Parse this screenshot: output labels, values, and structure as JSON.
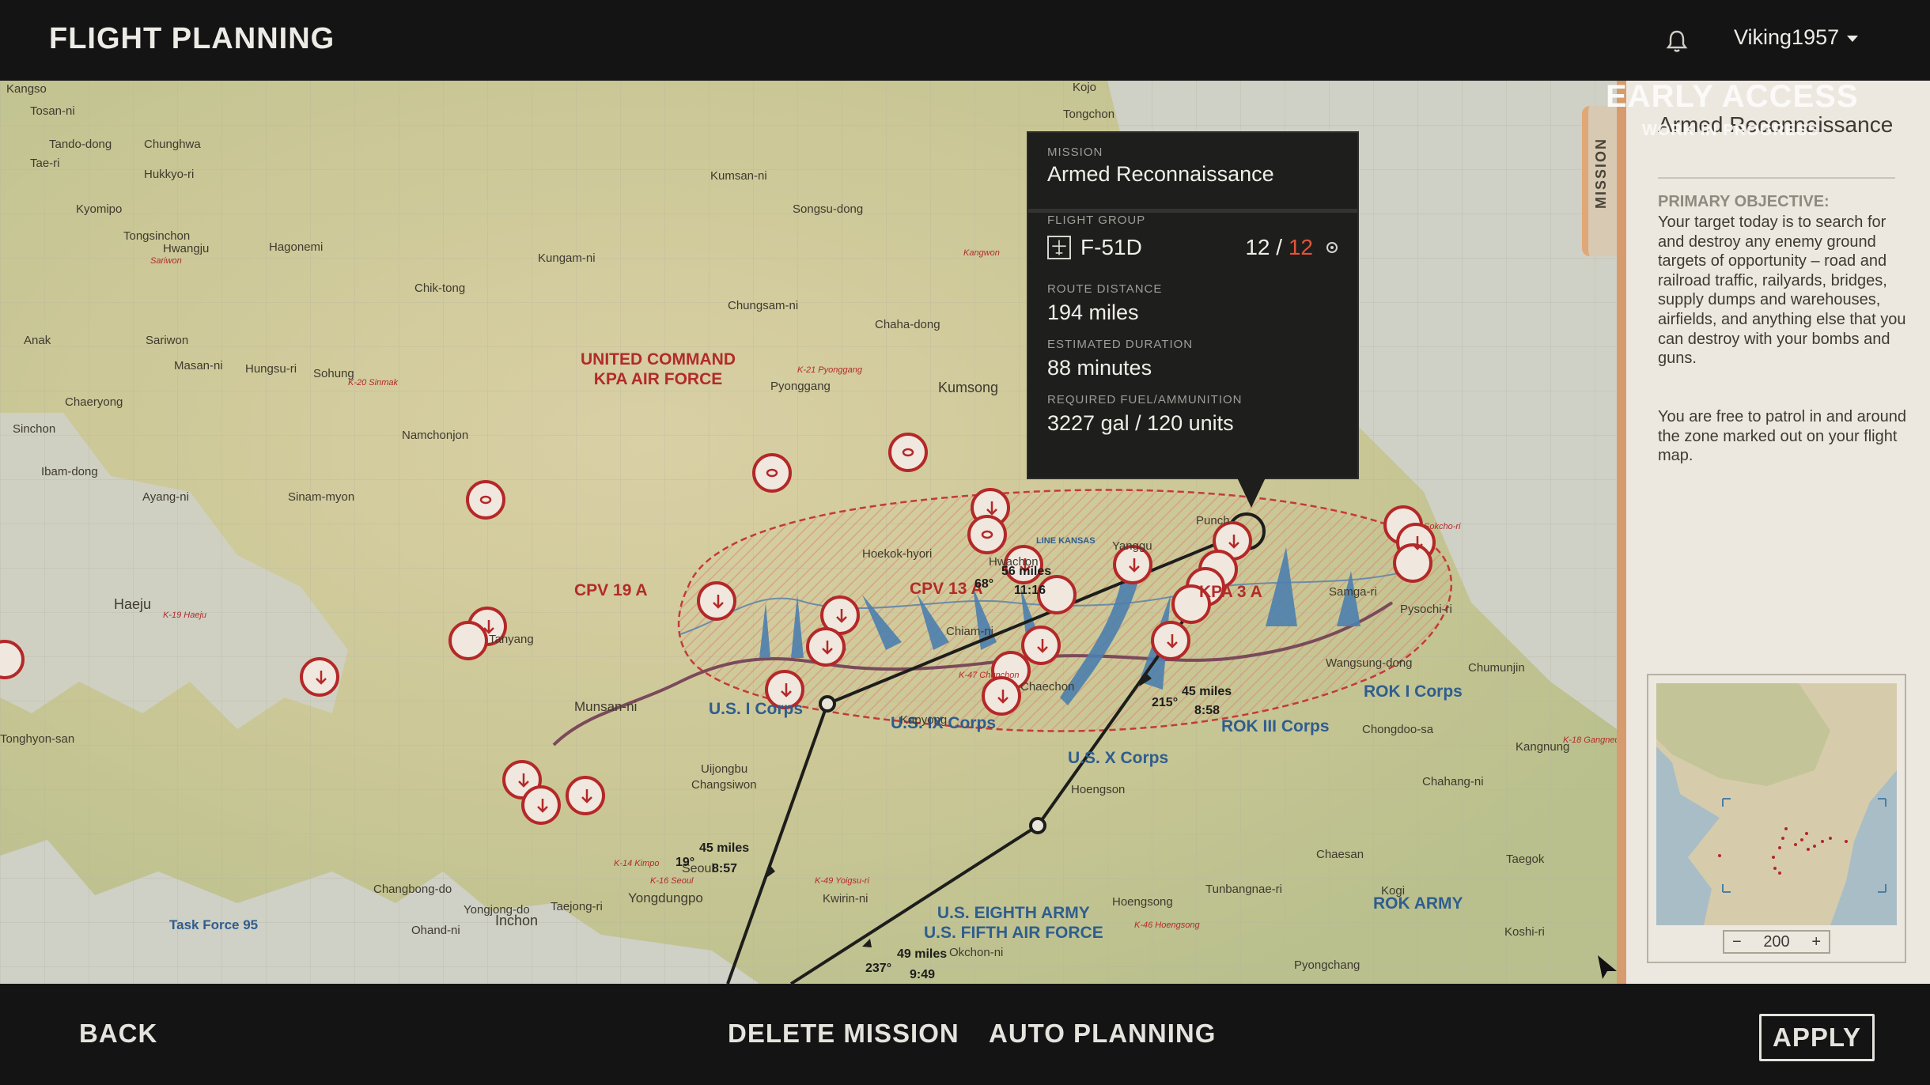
{
  "app": {
    "title": "FLIGHT PLANNING",
    "user": "Viking1957"
  },
  "mission_card": {
    "mission_label": "MISSION",
    "mission_name": "Armed Reconnaissance",
    "flight_group_label": "FLIGHT GROUP",
    "aircraft": "F-51D",
    "count_current": "12",
    "count_sep": " / ",
    "count_max": "12",
    "route_distance_label": "ROUTE DISTANCE",
    "route_distance": "194 miles",
    "duration_label": "ESTIMATED DURATION",
    "duration": "88 minutes",
    "fuel_label": "REQUIRED FUEL/AMMUNITION",
    "fuel": "3227 gal / 120 units"
  },
  "sidebar": {
    "tab": "MISSION",
    "badge": "EARLY ACCESS",
    "badge_sub": "WORK IN PROGRESS",
    "title": "Armed Reconnaissance",
    "objective_heading": "PRIMARY OBJECTIVE:",
    "objective_text": "Your target today is to search for and destroy any enemy ground targets of opportunity – road and railroad traffic, railyards, bridges, supply dumps and warehouses, airfields, and anything else that you can destroy with your bombs and guns.",
    "objective_text2": "You are free to patrol in and around the zone marked out on your flight map.",
    "zoom_minus": "−",
    "zoom_value": "200",
    "zoom_plus": "+"
  },
  "bottom": {
    "back": "BACK",
    "delete": "DELETE MISSION",
    "auto": "AUTO PLANNING",
    "apply": "APPLY"
  },
  "map": {
    "labels": {
      "kpa": "UNITED COMMAND\nKPA AIR FORCE",
      "cpv19": "CPV 19 A",
      "cpv13": "CPV 13 A",
      "kpa3": "KPA 3 A",
      "usi": "U.S. I Corps",
      "usix": "U.S. IX Corps",
      "usx": "U.S. X Corps",
      "roki": "ROK I Corps",
      "rokiii": "ROK III Corps",
      "rokarmy": "ROK ARMY",
      "eighth": "U.S. EIGHTH ARMY\nU.S. FIFTH AIR FORCE",
      "tf95": "Task Force 95",
      "line_kansas": "LINE KANSAS"
    },
    "places": [
      "Kangso",
      "Tosan-ni",
      "Tando-dong",
      "Chunghwa",
      "Hukkyo-ri",
      "Tae-ri",
      "Kyomipo",
      "Tongsinchon",
      "Hwangju",
      "Sariwon",
      "Hagonemi",
      "Kungam-ni",
      "Kumsan-ni",
      "Songsu-dong",
      "Chik-tong",
      "Chungsam-ni",
      "Chaha-dong",
      "Anak",
      "Masan-ni",
      "Hungsu-ri",
      "Sohung",
      "Chaeryong",
      "Pyonggang",
      "Kumsong",
      "Sinchon",
      "Namchonjon",
      "Ibam-dong",
      "Ayang-ni",
      "Sinam-myon",
      "Haeju",
      "Hoekok-hyori",
      "Munsan-ni",
      "Uijongbu",
      "Changsiwon",
      "Seoul",
      "Yongdungpo",
      "Kwirin-ni",
      "Okchon-ni",
      "Inchon",
      "Ohand-ni",
      "Chaechon",
      "Changbong-do",
      "Yongjong-do",
      "Taejong-ri",
      "Chumunjin",
      "Chongdoo-sa",
      "Kangnung",
      "Chahang-ni",
      "Hoengson",
      "Chaesan",
      "Taegok",
      "Tunbangnae-ri",
      "Hoengsong",
      "Kogi",
      "Koshi-ri",
      "Pyongchang",
      "Kojo",
      "Tongchon",
      "Samga-ri",
      "Pysochi-ri",
      "Wangsung-dong",
      "Kapyong",
      "Tonghyon-san",
      "Tanyang",
      "Chiam-ni",
      "Hwachon",
      "Yanggu",
      "Punch"
    ],
    "airfields": [
      "K-19 Haeju",
      "K-20 Sinmak",
      "K-21 Pyonggang",
      "K-47 Chunchon",
      "K-14 Kimpo",
      "K-16 Seoul",
      "K-49 Yoigsu-ri",
      "K-46 Hoengsong",
      "K-18 Gangneu",
      "Sariwon",
      "Kangwon",
      "Sokcho-ri"
    ],
    "routes": [
      {
        "heading": "19°",
        "distance": "45 miles",
        "time": "8:57"
      },
      {
        "heading": "237°",
        "distance": "49 miles",
        "time": "9:49"
      },
      {
        "heading": "215°",
        "distance": "45 miles",
        "time": "8:58"
      },
      {
        "heading": "68°",
        "distance": "56 miles",
        "time": "11:16"
      }
    ]
  }
}
